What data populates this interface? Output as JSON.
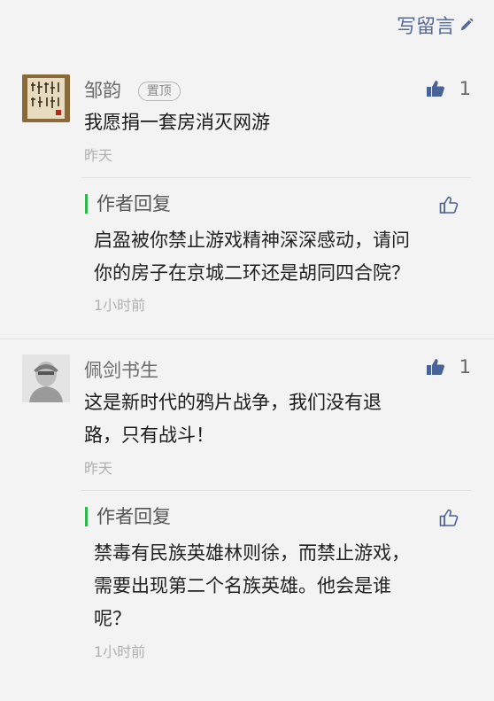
{
  "header": {
    "write_comment": "写留言"
  },
  "comments": [
    {
      "nickname": "邹韵",
      "pinned_badge": "置顶",
      "likes": "1",
      "text": "我愿捐一套房消灭网游",
      "time": "昨天",
      "reply": {
        "label": "作者回复",
        "lines": [
          "启盈被你禁止游戏精神深深感动，请问",
          "你的房子在京城二环还是胡同四合院？"
        ],
        "time": "1小时前"
      }
    },
    {
      "nickname": "佩剑书生",
      "likes": "1",
      "lines": [
        "这是新时代的鸦片战争，我们没有退",
        "路，只有战斗！"
      ],
      "time": "昨天",
      "reply": {
        "label": "作者回复",
        "lines": [
          "禁毒有民族英雄林则徐，而禁止游戏，",
          "需要出现第二个名族英雄。他会是谁",
          "呢？"
        ],
        "time": "1小时前"
      }
    }
  ],
  "colors": {
    "link": "#576b95",
    "accent_bar": "#2db84d",
    "thumb": "#4a6396"
  }
}
